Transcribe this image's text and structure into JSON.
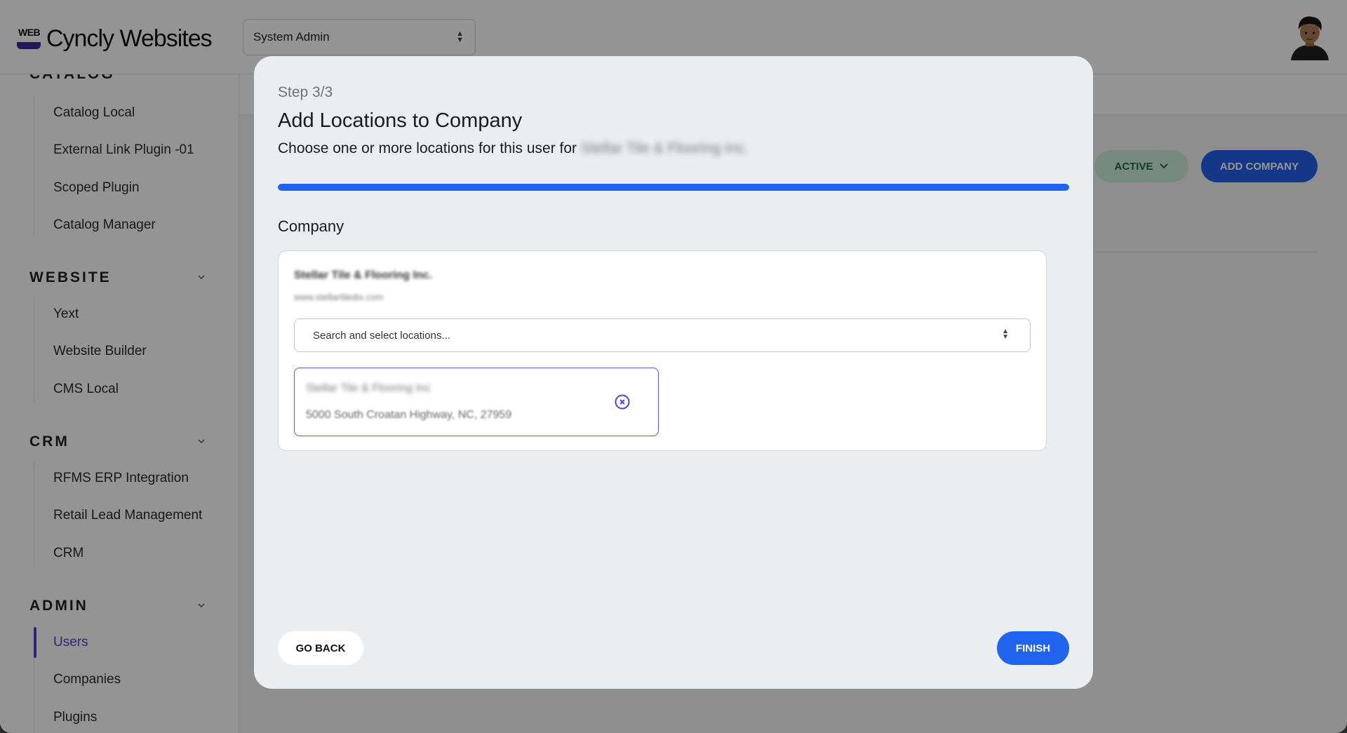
{
  "header": {
    "logo_badge": "WEB",
    "app_name": "Cyncly Websites",
    "role_select_value": "System Admin"
  },
  "sidebar": {
    "sections": [
      {
        "title": "CATALOG",
        "items": [
          "Catalog Local",
          "External Link Plugin -01",
          "Scoped Plugin",
          "Catalog Manager"
        ]
      },
      {
        "title": "WEBSITE",
        "items": [
          "Yext",
          "Website Builder",
          "CMS Local"
        ]
      },
      {
        "title": "CRM",
        "items": [
          "RFMS ERP Integration",
          "Retail Lead Management",
          "CRM"
        ]
      },
      {
        "title": "ADMIN",
        "items": [
          "Users",
          "Companies",
          "Plugins"
        ]
      }
    ],
    "active_item": "Users"
  },
  "main": {
    "status_filter": "ACTIVE",
    "add_company_label": "ADD COMPANY"
  },
  "modal": {
    "step": "Step 3/3",
    "title": "Add Locations to Company",
    "subtitle": "Choose one or more locations for this user for",
    "subtitle_company": "Stellar Tile & Flooring Inc.",
    "progress": 1.0,
    "company_label": "Company",
    "company": {
      "name": "Stellar Tile & Flooring Inc.",
      "url": "www.stellartiledix.com"
    },
    "location_select_placeholder": "Search and select locations...",
    "selected_locations": [
      {
        "name": "Stellar Tile & Flooring Inc",
        "address": "5000 South Croatan Highway, NC, 27959"
      }
    ],
    "go_back_label": "GO BACK",
    "finish_label": "FINISH"
  },
  "colors": {
    "accent": "#1f63ef",
    "active_nav": "#5b3fd0",
    "active_pill_bg": "#cfeedd",
    "active_pill_text": "#1f6b43"
  }
}
